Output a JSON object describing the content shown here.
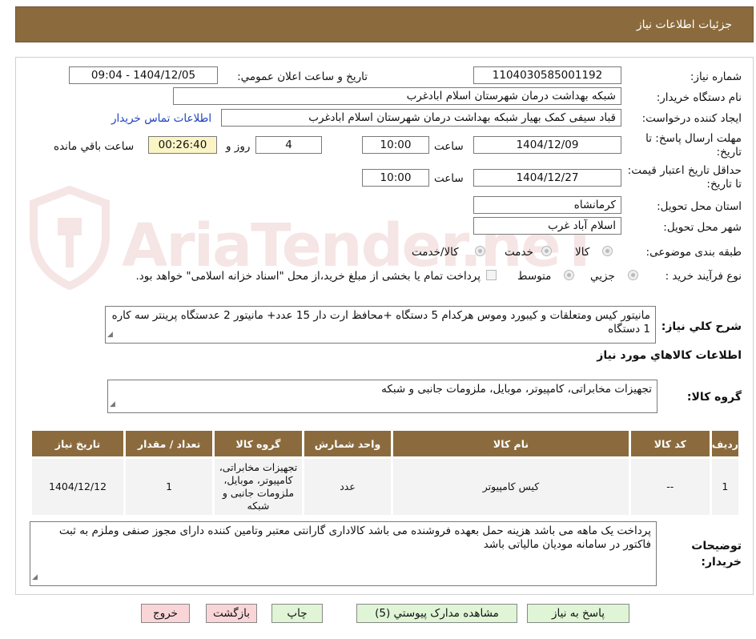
{
  "header": {
    "title": "جزئیات اطلاعات نیاز"
  },
  "watermark": {
    "text": "AriaTender.neT"
  },
  "form": {
    "need_number_label": "شماره نیاز:",
    "need_number": "1104030585001192",
    "announce_label": "تاریخ و ساعت اعلان عمومي:",
    "announce_value": "1404/12/05 - 09:04",
    "buyer_org_label": "نام دستگاه خریدار:",
    "buyer_org": "شبکه بهداشت درمان شهرستان اسلام ابادغرب",
    "requester_label": "ایجاد کننده درخواست:",
    "requester": "قباد سیفی کمک بهیار شبکه بهداشت درمان شهرستان اسلام ابادغرب",
    "contact_link": "اطلاعات تماس خریدار",
    "deadline_label": "مهلت ارسال پاسخ: تا تاریخ:",
    "deadline_date": "1404/12/09",
    "time_word": "ساعت",
    "deadline_time": "10:00",
    "days_value": "4",
    "days_and": "روز و",
    "remaining_time": "00:26:40",
    "remaining_label": "ساعت باقي مانده",
    "validity_label": "حداقل تاریخ اعتبار قیمت: تا تاریخ:",
    "validity_date": "1404/12/27",
    "validity_time": "10:00",
    "province_label": "استان محل تحویل:",
    "province": "کرمانشاه",
    "city_label": "شهر محل تحویل:",
    "city": "اسلام آباد غرب",
    "category_label": "طبقه بندی موضوعی:",
    "category_options": [
      "کالا",
      "خدمت",
      "کالا/خدمت"
    ],
    "process_label": "نوع فرآیند خرید :",
    "process_options": [
      "جزیي",
      "متوسط"
    ],
    "payment_note": "پرداخت تمام یا بخشی از مبلغ خرید،از محل \"اسناد خزانه اسلامی\" خواهد بود."
  },
  "summary": {
    "label": "شرح کلي نیاز:",
    "text": "مانیتور کیس ومتعلقات و کیبورد وموس هرکدام 5 دستگاه +محافظ ارت دار 15 عدد+ مانیتور 2 عدستگاه  پرینتر سه کاره 1 دستگاه"
  },
  "goods": {
    "section_title": "اطلاعات کالاهاي مورد نیاز",
    "group_label": "گروه کالا:",
    "group_value": "تجهیزات مخابراتی، کامپیوتر، موبایل، ملزومات جانبی و شبکه"
  },
  "table": {
    "headers": [
      "ردیف",
      "کد کالا",
      "نام کالا",
      "واحد شمارش",
      "گروه کالا",
      "تعداد / مقدار",
      "تاریخ نیاز"
    ],
    "rows": [
      {
        "row": "1",
        "code": "--",
        "name": "کیس کامپیوتر",
        "unit": "عدد",
        "group": "تجهیزات مخابراتی، کامپیوتر، موبایل، ملزومات جانبی و شبکه",
        "qty": "1",
        "date": "1404/12/12"
      }
    ]
  },
  "buyer_notes": {
    "label": "توضیحات خریدار:",
    "text": "پرداخت یک ماهه می باشد هزینه حمل بعهده فروشنده می باشد کالاداری گارانتی معتبر وتامین کننده دارای مجوز صنفی وملزم به ثبت فاکتور در سامانه مودیان مالیاتی باشد"
  },
  "buttons": {
    "reply": "پاسخ به نیاز",
    "docs": "مشاهده مدارک پیوستي (5)",
    "print": "چاپ",
    "back": "بازگشت",
    "exit": "خروج"
  },
  "colors": {
    "header_bg": "#8b6b3d",
    "button_green": "#dff5d6",
    "button_pink": "#f9d5d7",
    "link": "#2040c0",
    "remaining_bg": "#fbf5c6"
  }
}
